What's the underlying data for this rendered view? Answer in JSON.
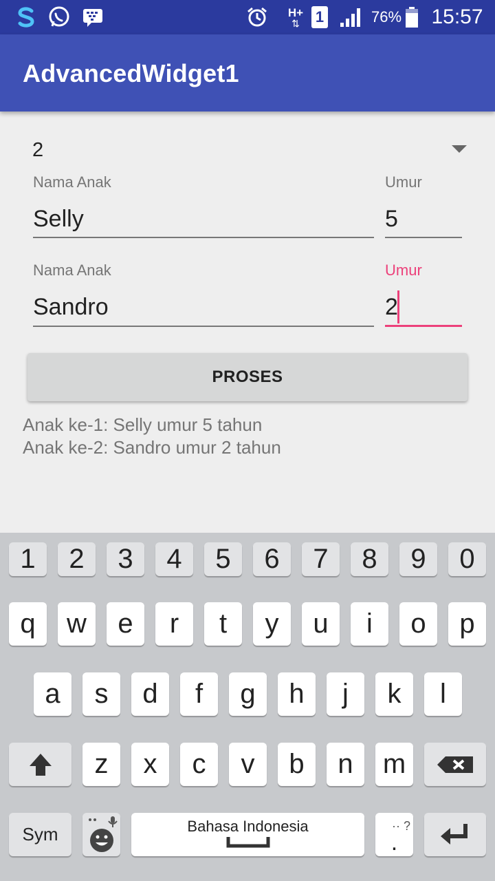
{
  "status_bar": {
    "battery": "76%",
    "time": "15:57",
    "network": "H+",
    "sim": "1"
  },
  "app": {
    "title": "AdvancedWidget1"
  },
  "spinner": {
    "value": "2"
  },
  "rows": [
    {
      "name_label": "Nama Anak",
      "name_value": "Selly",
      "age_label": "Umur",
      "age_value": "5"
    },
    {
      "name_label": "Nama Anak",
      "name_value": "Sandro",
      "age_label": "Umur",
      "age_value": "2"
    }
  ],
  "button": {
    "label": "PROSES"
  },
  "results": [
    "Anak ke-1: Selly umur 5 tahun",
    "Anak ke-2: Sandro umur 2 tahun"
  ],
  "keyboard": {
    "numbers": [
      "1",
      "2",
      "3",
      "4",
      "5",
      "6",
      "7",
      "8",
      "9",
      "0"
    ],
    "row1": [
      "q",
      "w",
      "e",
      "r",
      "t",
      "y",
      "u",
      "i",
      "o",
      "p"
    ],
    "row2": [
      "a",
      "s",
      "d",
      "f",
      "g",
      "h",
      "j",
      "k",
      "l"
    ],
    "row3": [
      "z",
      "x",
      "c",
      "v",
      "b",
      "n",
      "m"
    ],
    "sym_label": "Sym",
    "space_label": "Bahasa Indonesia",
    "punct_top": "·· ?",
    "punct_bottom": "."
  }
}
